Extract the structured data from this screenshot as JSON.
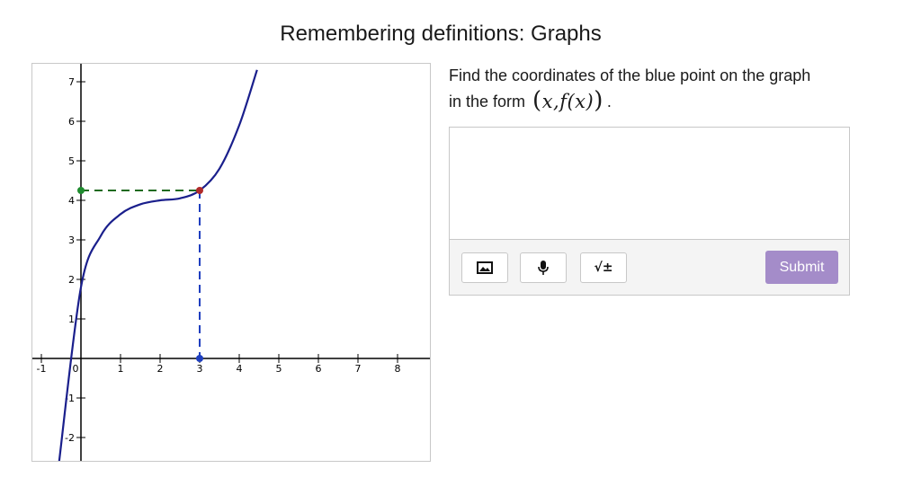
{
  "page": {
    "title": "Remembering definitions: Graphs"
  },
  "question": {
    "line1": "Find the coordinates of the blue point on the graph",
    "line2": "in the form",
    "math": "x,f(x)",
    "period": "."
  },
  "answer": {
    "value": "",
    "placeholder": ""
  },
  "toolbar": {
    "image_icon": "image-icon",
    "mic_icon": "microphone-icon",
    "math_label": "√±",
    "submit_label": "Submit"
  },
  "graph": {
    "x_ticks": [
      "-1",
      "0",
      "1",
      "2",
      "3",
      "4",
      "5",
      "6",
      "7",
      "8"
    ],
    "y_ticks": [
      "7",
      "6",
      "5",
      "4",
      "3",
      "2",
      "1",
      "-1",
      "-2"
    ],
    "curve_color": "#1a1f8c",
    "blue_point_color": "#1f3fbf",
    "green_point_color": "#1f8c2f",
    "red_point_color": "#b02a2a"
  },
  "chart_data": {
    "type": "line",
    "xlim": [
      -1.1,
      8.3
    ],
    "ylim": [
      -2.6,
      7.3
    ],
    "grid": false,
    "series": [
      {
        "x": [
          -0.55,
          0,
          0.5,
          1,
          1.5,
          2,
          2.5,
          3,
          3.5,
          4,
          4.45
        ],
        "y": [
          -2.6,
          1.8,
          3.1,
          3.65,
          3.9,
          4.0,
          4.05,
          4.25,
          4.8,
          5.9,
          7.3
        ]
      }
    ],
    "points": [
      {
        "x": 3,
        "y": 4.25,
        "color": "#b02a2a"
      },
      {
        "x": 3,
        "y": 0,
        "color": "#1f3fbf"
      },
      {
        "x": 0,
        "y": 4.25,
        "color": "#1f8c2f"
      }
    ],
    "guides": [
      {
        "from": [
          0,
          4.25
        ],
        "to": [
          3,
          4.25
        ],
        "color": "#1f6a1f",
        "style": "dashed"
      },
      {
        "from": [
          3,
          4.25
        ],
        "to": [
          3,
          0
        ],
        "color": "#1f3fbf",
        "style": "dashed"
      }
    ]
  }
}
